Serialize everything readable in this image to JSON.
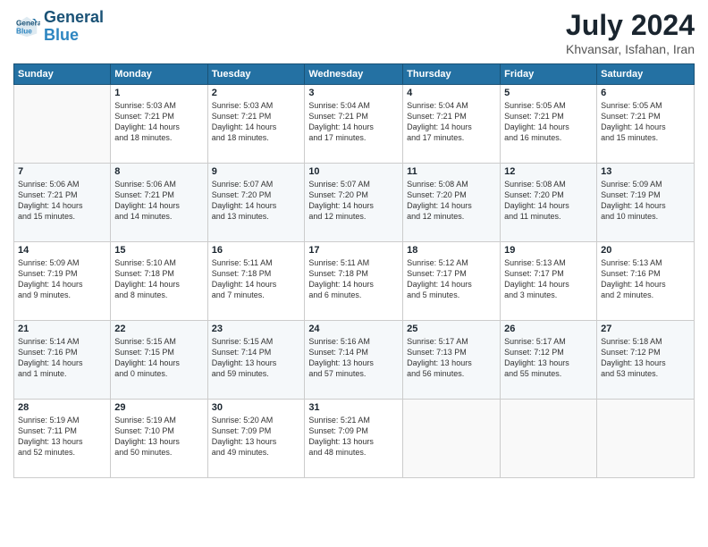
{
  "header": {
    "logo_line1": "General",
    "logo_line2": "Blue",
    "month": "July 2024",
    "location": "Khvansar, Isfahan, Iran"
  },
  "weekdays": [
    "Sunday",
    "Monday",
    "Tuesday",
    "Wednesday",
    "Thursday",
    "Friday",
    "Saturday"
  ],
  "weeks": [
    [
      {
        "day": "",
        "info": ""
      },
      {
        "day": "1",
        "info": "Sunrise: 5:03 AM\nSunset: 7:21 PM\nDaylight: 14 hours\nand 18 minutes."
      },
      {
        "day": "2",
        "info": "Sunrise: 5:03 AM\nSunset: 7:21 PM\nDaylight: 14 hours\nand 18 minutes."
      },
      {
        "day": "3",
        "info": "Sunrise: 5:04 AM\nSunset: 7:21 PM\nDaylight: 14 hours\nand 17 minutes."
      },
      {
        "day": "4",
        "info": "Sunrise: 5:04 AM\nSunset: 7:21 PM\nDaylight: 14 hours\nand 17 minutes."
      },
      {
        "day": "5",
        "info": "Sunrise: 5:05 AM\nSunset: 7:21 PM\nDaylight: 14 hours\nand 16 minutes."
      },
      {
        "day": "6",
        "info": "Sunrise: 5:05 AM\nSunset: 7:21 PM\nDaylight: 14 hours\nand 15 minutes."
      }
    ],
    [
      {
        "day": "7",
        "info": "Sunrise: 5:06 AM\nSunset: 7:21 PM\nDaylight: 14 hours\nand 15 minutes."
      },
      {
        "day": "8",
        "info": "Sunrise: 5:06 AM\nSunset: 7:21 PM\nDaylight: 14 hours\nand 14 minutes."
      },
      {
        "day": "9",
        "info": "Sunrise: 5:07 AM\nSunset: 7:20 PM\nDaylight: 14 hours\nand 13 minutes."
      },
      {
        "day": "10",
        "info": "Sunrise: 5:07 AM\nSunset: 7:20 PM\nDaylight: 14 hours\nand 12 minutes."
      },
      {
        "day": "11",
        "info": "Sunrise: 5:08 AM\nSunset: 7:20 PM\nDaylight: 14 hours\nand 12 minutes."
      },
      {
        "day": "12",
        "info": "Sunrise: 5:08 AM\nSunset: 7:20 PM\nDaylight: 14 hours\nand 11 minutes."
      },
      {
        "day": "13",
        "info": "Sunrise: 5:09 AM\nSunset: 7:19 PM\nDaylight: 14 hours\nand 10 minutes."
      }
    ],
    [
      {
        "day": "14",
        "info": "Sunrise: 5:09 AM\nSunset: 7:19 PM\nDaylight: 14 hours\nand 9 minutes."
      },
      {
        "day": "15",
        "info": "Sunrise: 5:10 AM\nSunset: 7:18 PM\nDaylight: 14 hours\nand 8 minutes."
      },
      {
        "day": "16",
        "info": "Sunrise: 5:11 AM\nSunset: 7:18 PM\nDaylight: 14 hours\nand 7 minutes."
      },
      {
        "day": "17",
        "info": "Sunrise: 5:11 AM\nSunset: 7:18 PM\nDaylight: 14 hours\nand 6 minutes."
      },
      {
        "day": "18",
        "info": "Sunrise: 5:12 AM\nSunset: 7:17 PM\nDaylight: 14 hours\nand 5 minutes."
      },
      {
        "day": "19",
        "info": "Sunrise: 5:13 AM\nSunset: 7:17 PM\nDaylight: 14 hours\nand 3 minutes."
      },
      {
        "day": "20",
        "info": "Sunrise: 5:13 AM\nSunset: 7:16 PM\nDaylight: 14 hours\nand 2 minutes."
      }
    ],
    [
      {
        "day": "21",
        "info": "Sunrise: 5:14 AM\nSunset: 7:16 PM\nDaylight: 14 hours\nand 1 minute."
      },
      {
        "day": "22",
        "info": "Sunrise: 5:15 AM\nSunset: 7:15 PM\nDaylight: 14 hours\nand 0 minutes."
      },
      {
        "day": "23",
        "info": "Sunrise: 5:15 AM\nSunset: 7:14 PM\nDaylight: 13 hours\nand 59 minutes."
      },
      {
        "day": "24",
        "info": "Sunrise: 5:16 AM\nSunset: 7:14 PM\nDaylight: 13 hours\nand 57 minutes."
      },
      {
        "day": "25",
        "info": "Sunrise: 5:17 AM\nSunset: 7:13 PM\nDaylight: 13 hours\nand 56 minutes."
      },
      {
        "day": "26",
        "info": "Sunrise: 5:17 AM\nSunset: 7:12 PM\nDaylight: 13 hours\nand 55 minutes."
      },
      {
        "day": "27",
        "info": "Sunrise: 5:18 AM\nSunset: 7:12 PM\nDaylight: 13 hours\nand 53 minutes."
      }
    ],
    [
      {
        "day": "28",
        "info": "Sunrise: 5:19 AM\nSunset: 7:11 PM\nDaylight: 13 hours\nand 52 minutes."
      },
      {
        "day": "29",
        "info": "Sunrise: 5:19 AM\nSunset: 7:10 PM\nDaylight: 13 hours\nand 50 minutes."
      },
      {
        "day": "30",
        "info": "Sunrise: 5:20 AM\nSunset: 7:09 PM\nDaylight: 13 hours\nand 49 minutes."
      },
      {
        "day": "31",
        "info": "Sunrise: 5:21 AM\nSunset: 7:09 PM\nDaylight: 13 hours\nand 48 minutes."
      },
      {
        "day": "",
        "info": ""
      },
      {
        "day": "",
        "info": ""
      },
      {
        "day": "",
        "info": ""
      }
    ]
  ]
}
